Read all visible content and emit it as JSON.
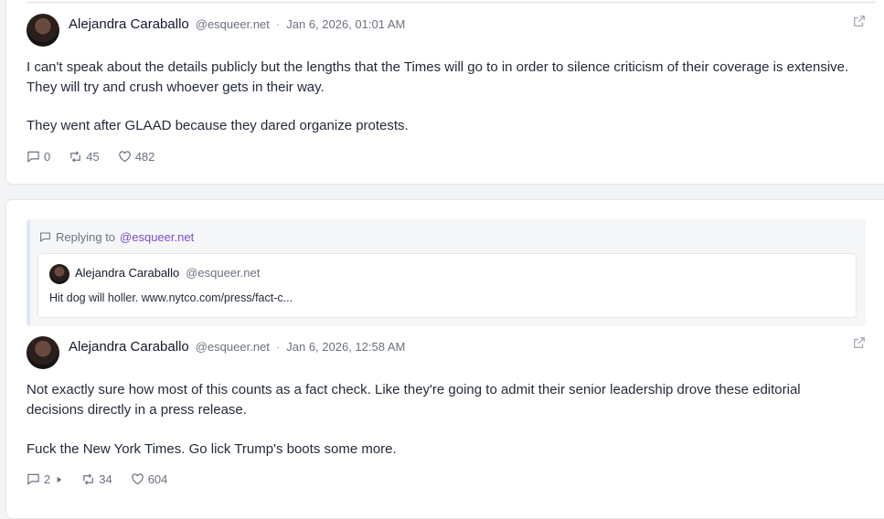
{
  "posts": [
    {
      "author": "Alejandra Caraballo",
      "handle": "@esqueer.net",
      "separator": "·",
      "time": "Jan 6, 2026, 01:01 AM",
      "paragraphs": [
        "I can't speak about the details publicly but the lengths that the Times will go to in order to silence criticism of their coverage is extensive. They will try and crush whoever gets in their way.",
        "They went after GLAAD because they dared organize protests."
      ],
      "replies": "0",
      "reposts": "45",
      "likes": "482"
    },
    {
      "replying_to_label": "Replying to",
      "replying_to_handle": "@esqueer.net",
      "quoted": {
        "author": "Alejandra Caraballo",
        "handle": "@esqueer.net",
        "text": "Hit dog will holler. www.nytco.com/press/fact-c..."
      },
      "author": "Alejandra Caraballo",
      "handle": "@esqueer.net",
      "separator": "·",
      "time": "Jan 6, 2026, 12:58 AM",
      "paragraphs": [
        "Not exactly sure how most of this counts as a fact check. Like they're going to admit their senior leadership drove these editorial decisions directly in a press release.",
        "Fuck the New York Times. Go lick Trump's boots some more."
      ],
      "replies": "2",
      "reposts": "34",
      "likes": "604"
    }
  ]
}
